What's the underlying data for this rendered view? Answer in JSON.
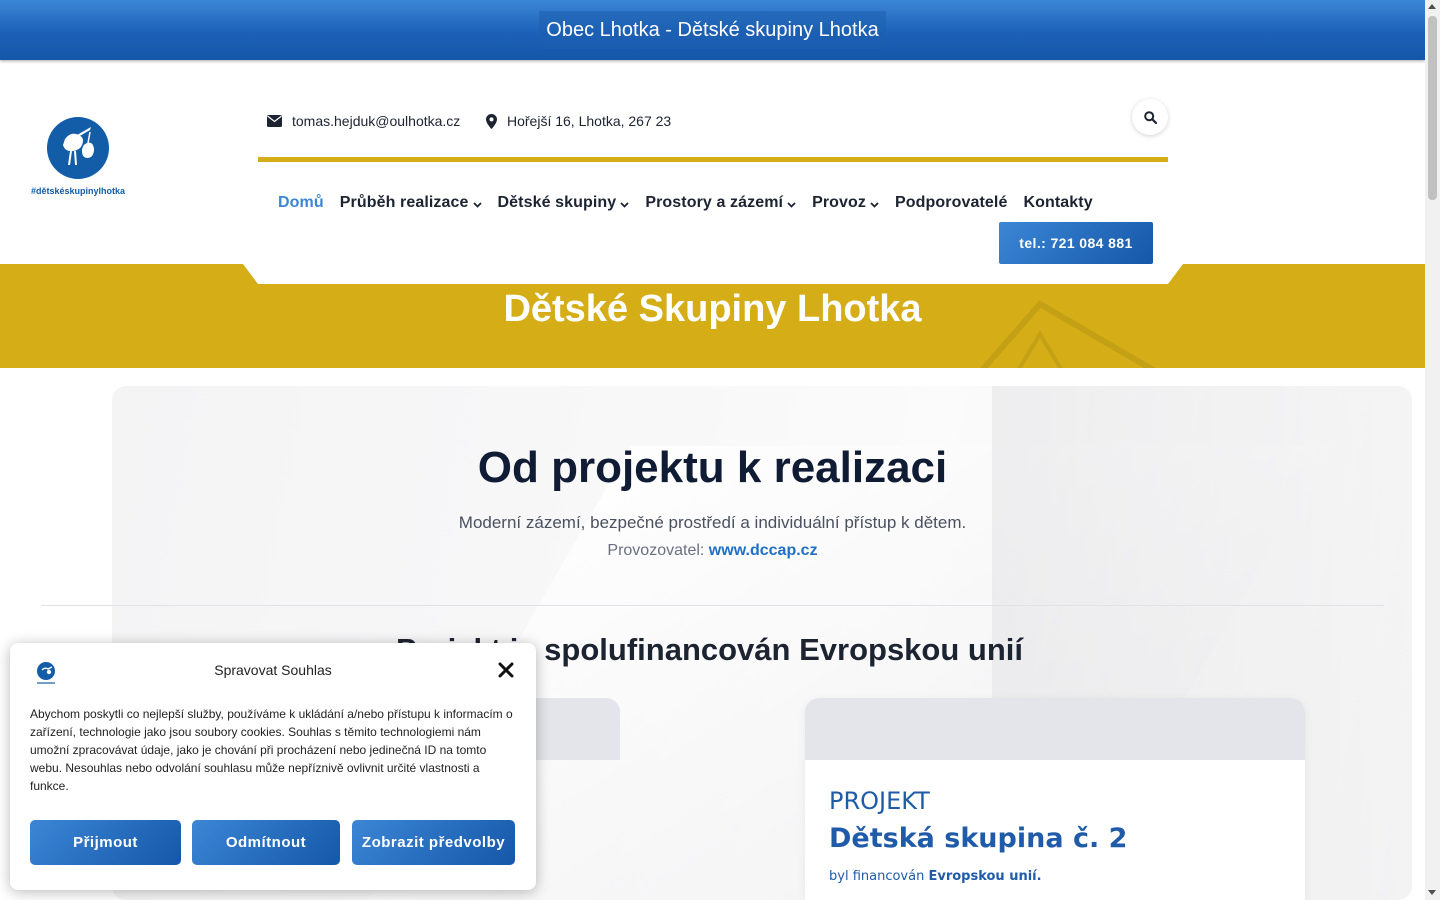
{
  "topbar": {
    "title": "Obec Lhotka - Dětské skupiny Lhotka"
  },
  "logo": {
    "caption": "#dětskéskupinylhotka"
  },
  "header": {
    "email": "tomas.hejduk@oulhotka.cz",
    "address": "Hořejší 16, Lhotka, 267 23",
    "phone_button": "tel.: 721 084 881"
  },
  "nav": {
    "items": [
      {
        "label": "Domů",
        "active": true,
        "dropdown": false
      },
      {
        "label": "Průběh realizace",
        "active": false,
        "dropdown": true
      },
      {
        "label": "Dětské skupiny",
        "active": false,
        "dropdown": true
      },
      {
        "label": "Prostory a zázemí",
        "active": false,
        "dropdown": true
      },
      {
        "label": "Provoz",
        "active": false,
        "dropdown": true
      },
      {
        "label": "Podporovatelé",
        "active": false,
        "dropdown": false
      },
      {
        "label": "Kontakty",
        "active": false,
        "dropdown": false
      }
    ]
  },
  "hero": {
    "title": "Dětské Skupiny Lhotka"
  },
  "main": {
    "title": "Od projektu k realizaci",
    "subtitle": "Moderní zázemí, bezpečné prostředí a individuální přístup k dětem.",
    "operator_label": "Provozovatel:",
    "operator_link": "www.dccap.cz",
    "eu_title": "Projekt je spolufinancován Evropskou unií"
  },
  "card": {
    "kicker": "PROJEKT",
    "title": "Dětská skupina č. 2",
    "line_prefix": "byl financován",
    "line_bold": "Evropskou unií."
  },
  "consent": {
    "title": "Spravovat Souhlas",
    "text": "Abychom poskytli co nejlepší služby, používáme k ukládání a/nebo přístupu k informacím o zařízení, technologie jako jsou soubory cookies. Souhlas s těmito technologiemi nám umožní zpracovávat údaje, jako je chování při procházení nebo jedinečná ID na tomto webu. Nesouhlas nebo odvolání souhlasu může nepříznivě ovlivnit určité vlastnosti a funkce.",
    "accept": "Přijmout",
    "decline": "Odmítnout",
    "preferences": "Zobrazit předvolby"
  },
  "colors": {
    "brand_blue": "#1557a8",
    "accent_blue": "#3a87d4",
    "gold": "#d4ad17",
    "dark_navy": "#101b34"
  },
  "icons": [
    "envelope-icon",
    "map-marker-icon",
    "search-icon",
    "chevron-down-icon",
    "close-icon",
    "stork-logo-icon"
  ]
}
